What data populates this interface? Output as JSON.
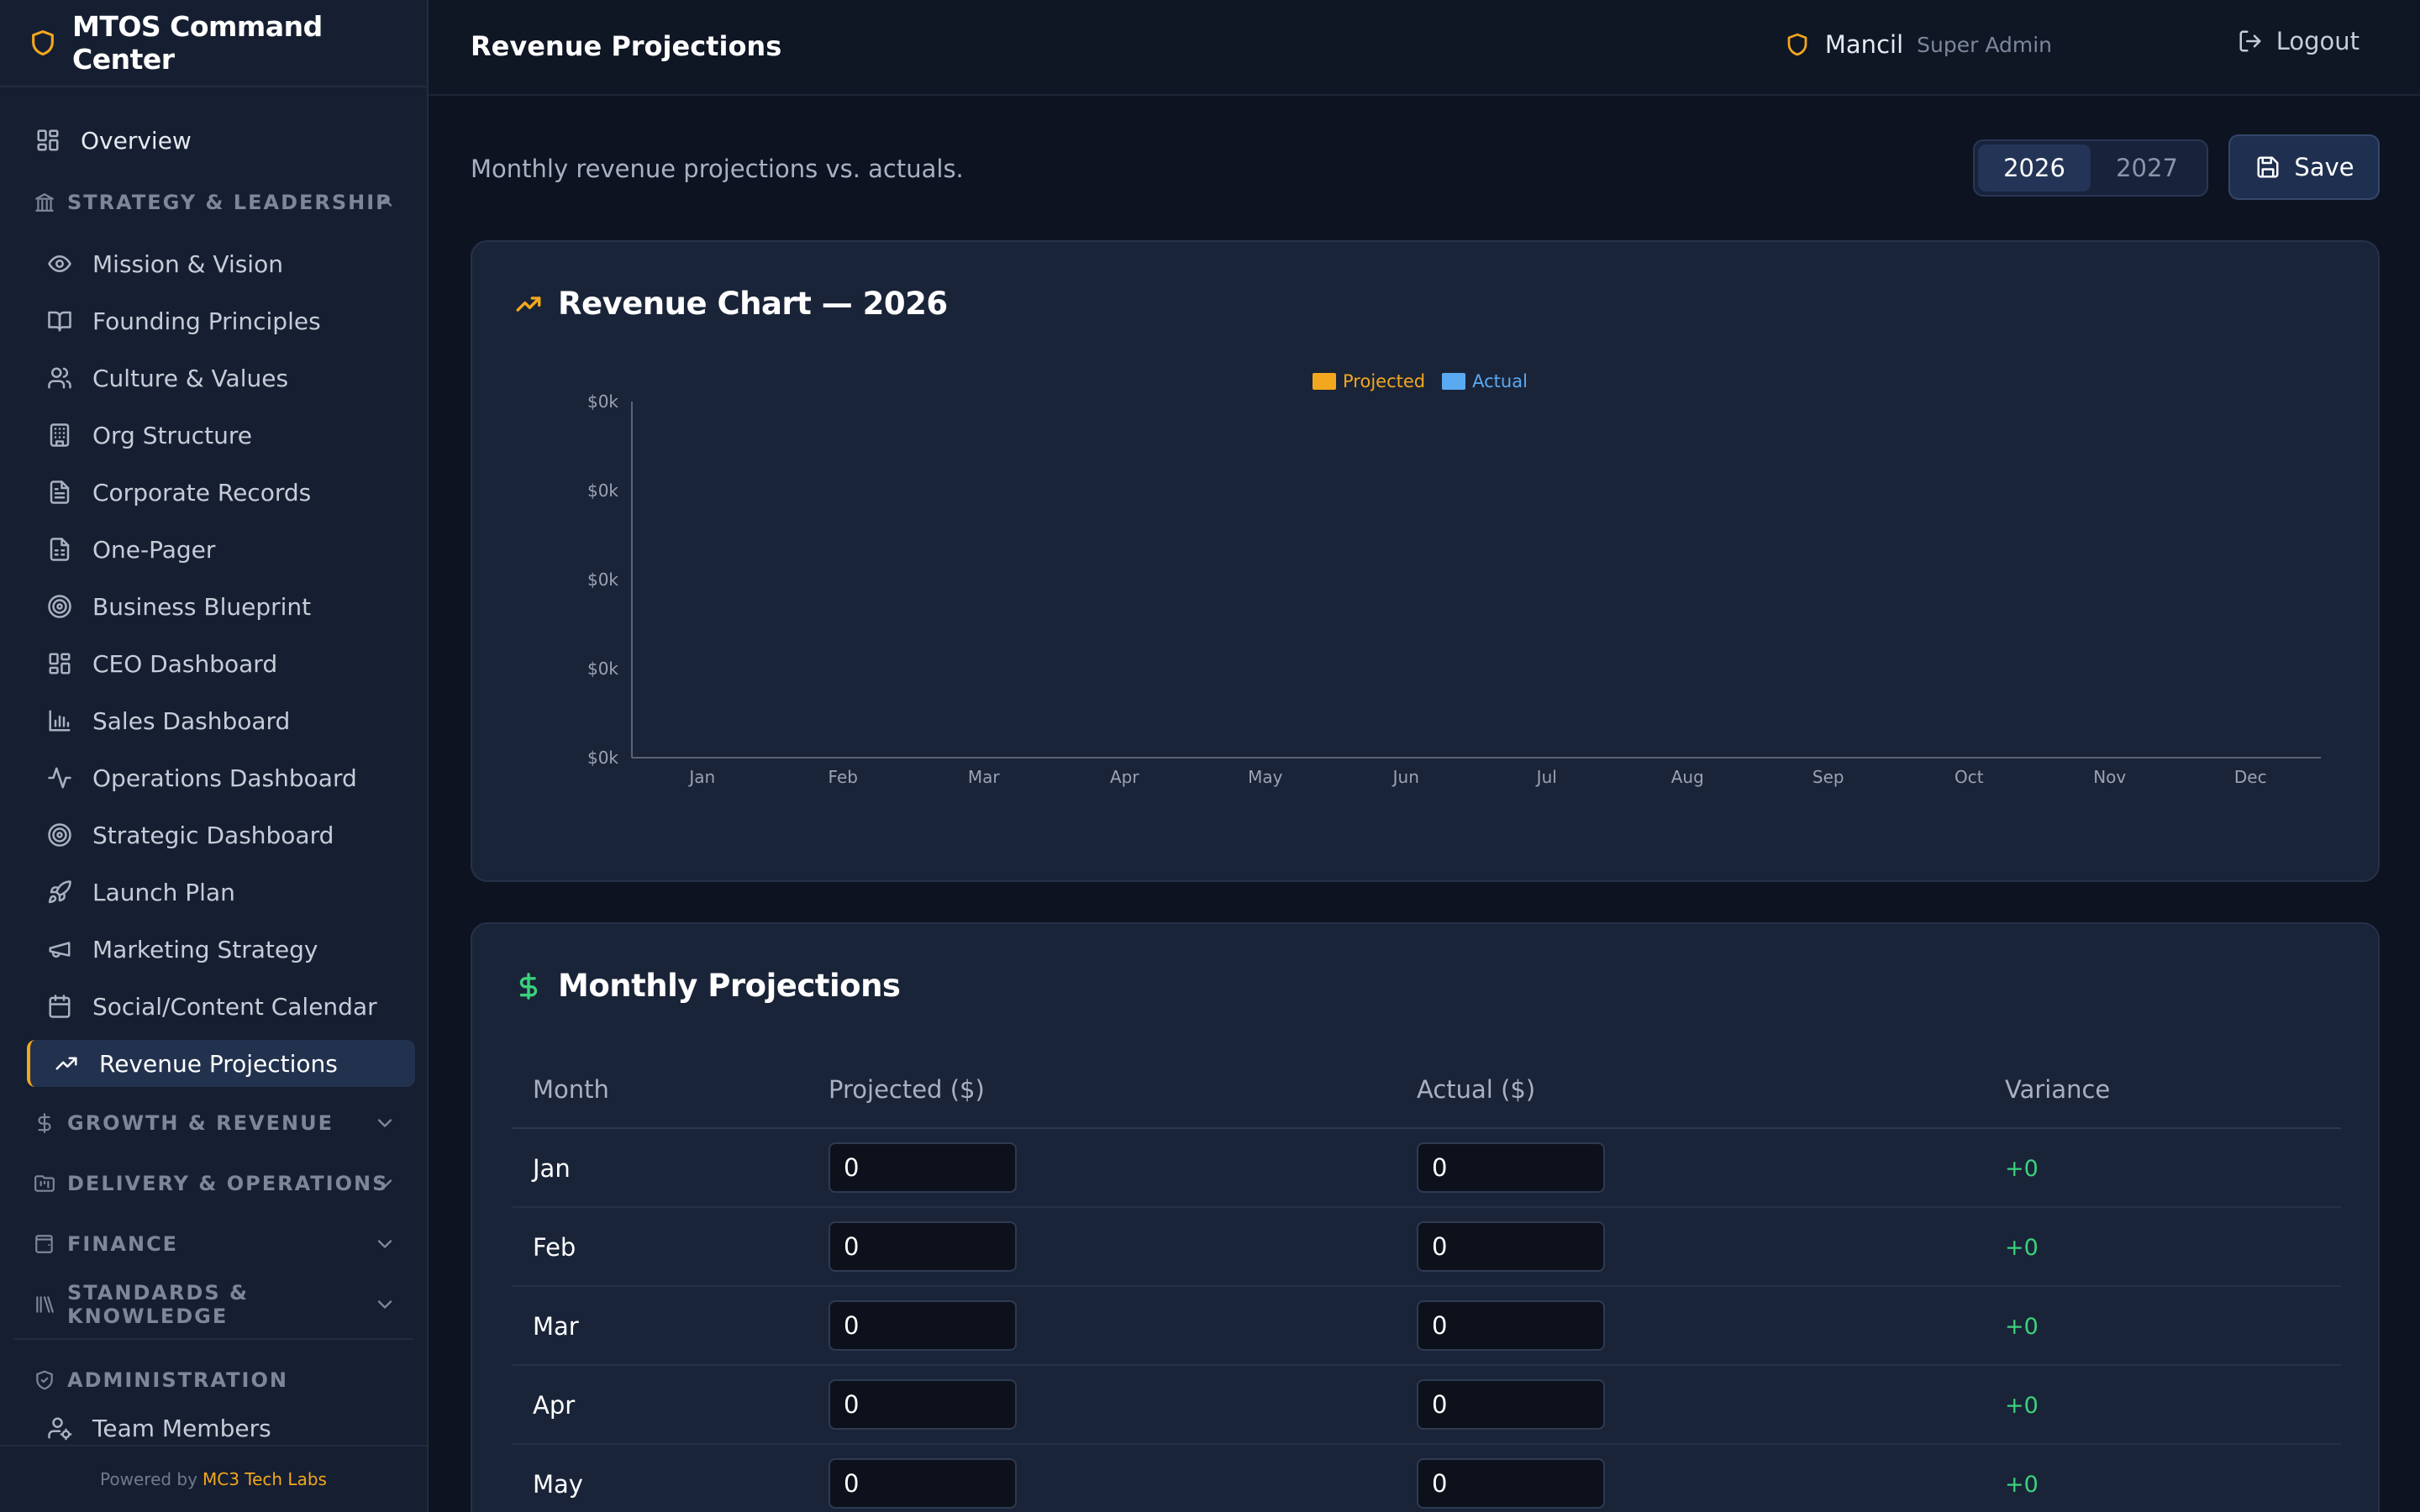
{
  "app": {
    "brand": "MTOS Command Center",
    "footer_prefix": "Powered by",
    "footer_brand": "MC3 Tech Labs"
  },
  "colors": {
    "accent": "#f2a71e",
    "projected": "#f2a71e",
    "actual": "#5aaaf2",
    "positive": "#3ad27c",
    "sidebar_bg": "#161f31",
    "card_bg": "#1a2438"
  },
  "sidebar": {
    "overview": {
      "label": "Overview",
      "icon": "grid-icon"
    },
    "sections": [
      {
        "label": "STRATEGY & LEADERSHIP",
        "icon": "landmark-icon",
        "expanded": true
      },
      {
        "label": "GROWTH & REVENUE",
        "icon": "dollar-icon",
        "expanded": false
      },
      {
        "label": "DELIVERY & OPERATIONS",
        "icon": "folder-kanban-icon",
        "expanded": false
      },
      {
        "label": "FINANCE",
        "icon": "wallet-icon",
        "expanded": false
      },
      {
        "label": "STANDARDS & KNOWLEDGE",
        "icon": "library-icon",
        "expanded": false
      },
      {
        "label": "ADMINISTRATION",
        "icon": "shield-check-icon",
        "expanded": true
      }
    ],
    "strategy_items": [
      {
        "label": "Mission & Vision",
        "icon": "eye-icon"
      },
      {
        "label": "Founding Principles",
        "icon": "book-open-icon"
      },
      {
        "label": "Culture & Values",
        "icon": "users-icon"
      },
      {
        "label": "Org Structure",
        "icon": "building-icon"
      },
      {
        "label": "Corporate Records",
        "icon": "file-text-icon"
      },
      {
        "label": "One-Pager",
        "icon": "file-spreadsheet-icon"
      },
      {
        "label": "Business Blueprint",
        "icon": "target-icon"
      },
      {
        "label": "CEO Dashboard",
        "icon": "layout-dashboard-icon"
      },
      {
        "label": "Sales Dashboard",
        "icon": "bar-chart-icon"
      },
      {
        "label": "Operations Dashboard",
        "icon": "activity-icon"
      },
      {
        "label": "Strategic Dashboard",
        "icon": "target-icon"
      },
      {
        "label": "Launch Plan",
        "icon": "rocket-icon"
      },
      {
        "label": "Marketing Strategy",
        "icon": "megaphone-icon"
      },
      {
        "label": "Social/Content Calendar",
        "icon": "calendar-icon"
      },
      {
        "label": "Revenue Projections",
        "icon": "trending-up-icon",
        "active": true
      }
    ],
    "admin_items": [
      {
        "label": "Team Members",
        "icon": "user-cog-icon"
      }
    ]
  },
  "header": {
    "title": "Revenue Projections",
    "user_name": "Mancil",
    "user_role": "Super Admin",
    "logout_label": "Logout"
  },
  "main": {
    "subtitle": "Monthly revenue projections vs. actuals.",
    "years": [
      "2026",
      "2027"
    ],
    "selected_year": "2026",
    "save_label": "Save"
  },
  "chart_card": {
    "title": "Revenue Chart — 2026"
  },
  "chart_data": {
    "type": "bar",
    "categories": [
      "Jan",
      "Feb",
      "Mar",
      "Apr",
      "May",
      "Jun",
      "Jul",
      "Aug",
      "Sep",
      "Oct",
      "Nov",
      "Dec"
    ],
    "series": [
      {
        "name": "Projected",
        "values": [
          0,
          0,
          0,
          0,
          0,
          0,
          0,
          0,
          0,
          0,
          0,
          0
        ]
      },
      {
        "name": "Actual",
        "values": [
          0,
          0,
          0,
          0,
          0,
          0,
          0,
          0,
          0,
          0,
          0,
          0
        ]
      }
    ],
    "y_ticks": [
      "$0k",
      "$0k",
      "$0k",
      "$0k",
      "$0k"
    ],
    "legend_position": "top-center",
    "grid": false
  },
  "table_card": {
    "title": "Monthly Projections",
    "columns": [
      "Month",
      "Projected ($)",
      "Actual ($)",
      "Variance"
    ],
    "rows": [
      {
        "month": "Jan",
        "projected": "0",
        "actual": "0",
        "variance": "+0"
      },
      {
        "month": "Feb",
        "projected": "0",
        "actual": "0",
        "variance": "+0"
      },
      {
        "month": "Mar",
        "projected": "0",
        "actual": "0",
        "variance": "+0"
      },
      {
        "month": "Apr",
        "projected": "0",
        "actual": "0",
        "variance": "+0"
      },
      {
        "month": "May",
        "projected": "0",
        "actual": "0",
        "variance": "+0"
      }
    ]
  }
}
